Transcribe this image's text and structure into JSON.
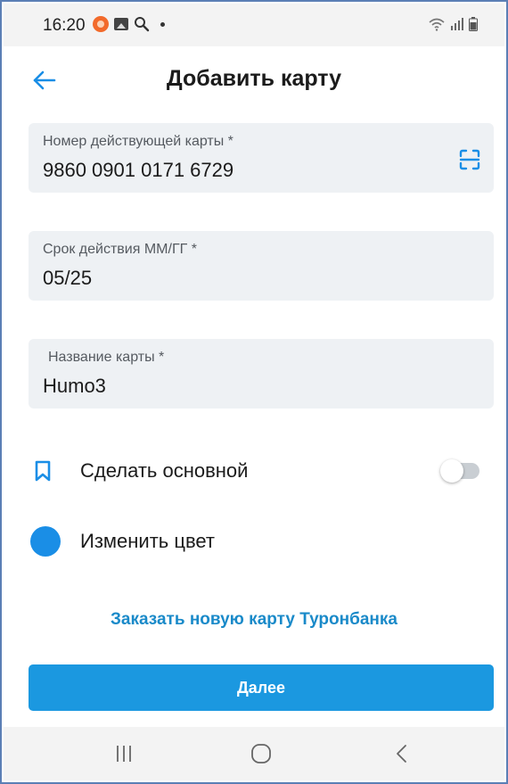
{
  "status_bar": {
    "time": "16:20",
    "icons": [
      "record-icon",
      "gallery-icon",
      "search-icon",
      "dot-icon",
      "wifi-icon",
      "signal-icon",
      "battery-icon"
    ]
  },
  "header": {
    "title": "Добавить карту",
    "back_icon": "arrow-left-icon"
  },
  "form": {
    "card_number": {
      "label": "Номер действующей карты *",
      "value": "9860 0901 0171 6729"
    },
    "expiry": {
      "label": "Срок действия ММ/ГГ *",
      "value": "05/25"
    },
    "card_name": {
      "label": "Название карты *",
      "value": "Humo3"
    }
  },
  "options": {
    "make_primary": {
      "label": "Сделать основной",
      "toggle_on": false
    },
    "change_color": {
      "label": "Изменить цвет",
      "color": "#1a8ee6"
    }
  },
  "order_link": "Заказать новую карту Туронбанка",
  "next_button": "Далее",
  "colors": {
    "accent": "#1b98e0",
    "link": "#1a8ac9",
    "field_bg": "#eef1f4"
  },
  "nav_bar": {
    "icons": [
      "recent-apps-icon",
      "home-icon",
      "back-icon"
    ]
  }
}
